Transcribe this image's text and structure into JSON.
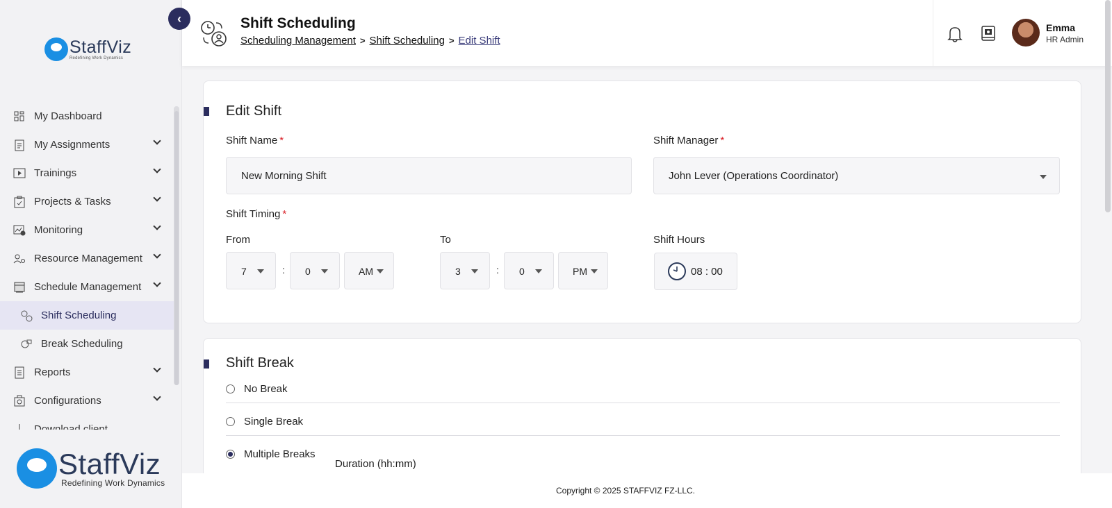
{
  "brand": {
    "name": "StaffViz",
    "tagline": "Redefining Work Dynamics"
  },
  "sidebar": {
    "items": [
      {
        "label": "My Dashboard",
        "icon": "dashboard-icon",
        "expandable": false
      },
      {
        "label": "My Assignments",
        "icon": "clipboard-icon",
        "expandable": true
      },
      {
        "label": "Trainings",
        "icon": "play-icon",
        "expandable": true
      },
      {
        "label": "Projects & Tasks",
        "icon": "task-icon",
        "expandable": true
      },
      {
        "label": "Monitoring",
        "icon": "monitor-icon",
        "expandable": true
      },
      {
        "label": "Resource Management",
        "icon": "resource-icon",
        "expandable": true
      },
      {
        "label": "Schedule Management",
        "icon": "calendar-icon",
        "expandable": true
      },
      {
        "label": "Shift Scheduling",
        "icon": "shift-icon",
        "sub": true,
        "active": true
      },
      {
        "label": "Break Scheduling",
        "icon": "break-icon",
        "sub": true
      },
      {
        "label": "Reports",
        "icon": "report-icon",
        "expandable": true
      },
      {
        "label": "Configurations",
        "icon": "config-icon",
        "expandable": true
      },
      {
        "label": "Download client",
        "icon": "download-icon",
        "expandable": false
      }
    ]
  },
  "header": {
    "title": "Shift Scheduling",
    "breadcrumb": [
      "Scheduling Management",
      "Shift Scheduling",
      "Edit Shift"
    ],
    "user": {
      "name": "Emma",
      "role": "HR Admin"
    }
  },
  "edit_shift": {
    "title": "Edit Shift",
    "shift_name_label": "Shift Name",
    "shift_name_value": "New Morning Shift",
    "shift_manager_label": "Shift Manager",
    "shift_manager_value": "John Lever (Operations Coordinator)",
    "shift_timing_label": "Shift Timing",
    "from_label": "From",
    "to_label": "To",
    "from": {
      "hour": "7",
      "minute": "0",
      "period": "AM"
    },
    "to": {
      "hour": "3",
      "minute": "0",
      "period": "PM"
    },
    "colon": ":",
    "shift_hours_label": "Shift Hours",
    "shift_hours_value": "08 : 00",
    "required_mark": "*"
  },
  "shift_break": {
    "title": "Shift Break",
    "options": [
      "No Break",
      "Single Break",
      "Multiple Breaks"
    ],
    "selected": "Multiple Breaks",
    "duration_label": "Duration (hh:mm)"
  },
  "footer": {
    "copyright": "Copyright © 2025 STAFFVIZ FZ-LLC."
  },
  "colors": {
    "accent": "#2b2d5e",
    "required": "#d91f26",
    "active_bg": "#e6e5f3",
    "logo_blue": "#1a8fe3"
  }
}
